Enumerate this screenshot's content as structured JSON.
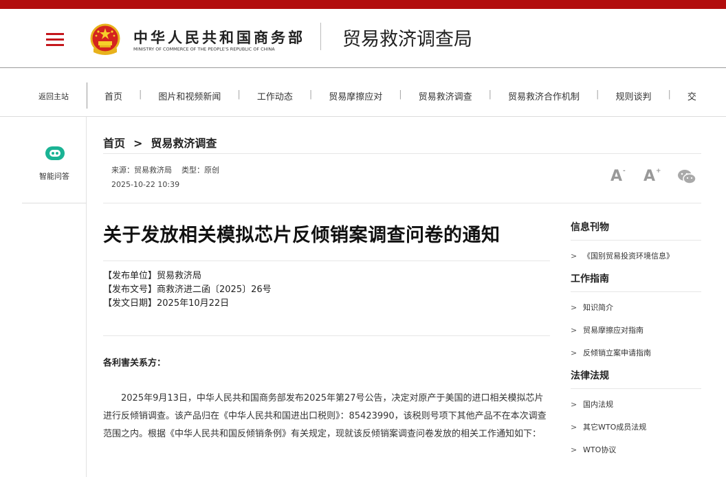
{
  "header": {
    "ministry_cn": "中华人民共和国商务部",
    "ministry_en": "MINISTRY OF COMMERCE OF THE PEOPLE'S REPUBLIC OF CHINA",
    "bureau": "贸易救济调查局"
  },
  "nav": {
    "home": "返回主站",
    "items": [
      {
        "label": "首页"
      },
      {
        "label": "图片和视频新闻"
      },
      {
        "label": "工作动态"
      },
      {
        "label": "贸易摩擦应对"
      },
      {
        "label": "贸易救济调查"
      },
      {
        "label": "贸易救济合作机制"
      },
      {
        "label": "规则谈判"
      },
      {
        "label": "交"
      }
    ]
  },
  "sidebar": {
    "qa_label": "智能问答"
  },
  "breadcrumb": {
    "home": "首页",
    "sep": ">",
    "current": "贸易救济调查"
  },
  "meta": {
    "source": "来源：贸易救济局",
    "type": "类型：原创",
    "date": "2025-10-22 10:39"
  },
  "tools": {
    "font_a": "A",
    "minus": "-",
    "plus": "+"
  },
  "article": {
    "title": "关于发放相关模拟芯片反倾销案调查问卷的通知",
    "info_lines": [
      "【发布单位】贸易救济局",
      "【发布文号】商救济进二函〔2025〕26号",
      "【发文日期】2025年10月22日"
    ],
    "salutation": "各利害关系方：",
    "paragraph": "2025年9月13日，中华人民共和国商务部发布2025年第27号公告，决定对原产于美国的进口相关模拟芯片进行反倾销调查。该产品归在《中华人民共和国进出口税则》：85423990，该税则号项下其他产品不在本次调查范围之内。根据《中华人民共和国反倾销条例》有关规定，现就该反倾销案调查问卷发放的相关工作通知如下："
  },
  "right": {
    "sections": [
      {
        "title": "信息刊物",
        "items": [
          "《国别贸易投资环境信息》"
        ]
      },
      {
        "title": "工作指南",
        "items": [
          "知识简介",
          "贸易摩擦应对指南",
          "反倾销立案申请指南"
        ]
      },
      {
        "title": "法律法规",
        "items": [
          "国内法规",
          "其它WTO成员法规",
          "WTO协议"
        ]
      }
    ],
    "arrow": ">"
  },
  "colors": {
    "brand_red": "#b20d0d",
    "accent_teal": "#1ab394"
  },
  "icons": [
    "menu-icon",
    "national-emblem-icon",
    "robot-icon",
    "font-decrease-icon",
    "font-increase-icon",
    "wechat-icon"
  ]
}
